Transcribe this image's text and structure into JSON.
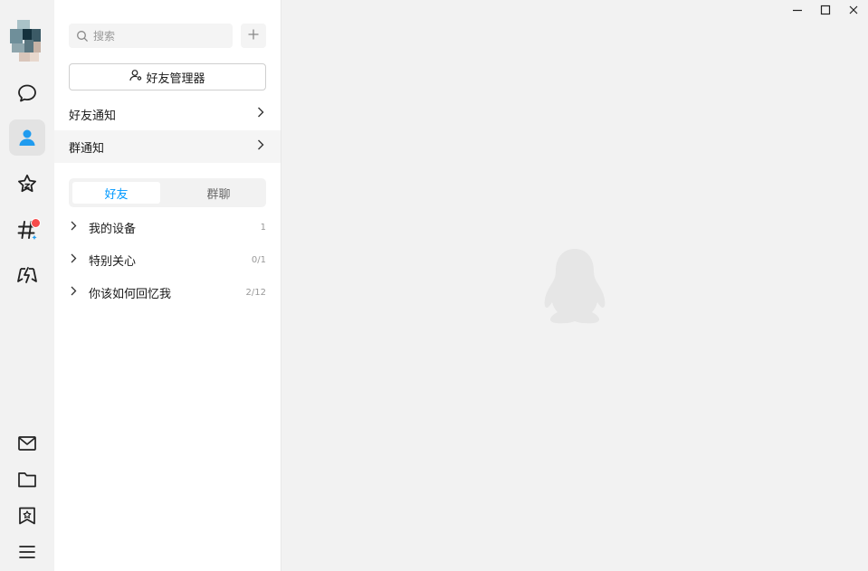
{
  "search": {
    "placeholder": "搜索"
  },
  "panel": {
    "manager_button": "好友管理器",
    "friend_notice": "好友通知",
    "group_notice": "群通知",
    "tabs": [
      {
        "label": "好友"
      },
      {
        "label": "群聊"
      }
    ],
    "groups": [
      {
        "name": "我的设备",
        "count": "1"
      },
      {
        "name": "特别关心",
        "count": "0/1"
      },
      {
        "name": "你该如何回忆我",
        "count": "2/12"
      }
    ]
  },
  "icons": {
    "rail_top": [
      "chat-bubble-icon",
      "contacts-person-icon",
      "star-icon",
      "channel-hash-icon",
      "game-lightning-icon"
    ],
    "rail_bottom": [
      "mail-icon",
      "folder-icon",
      "bookmark-star-icon",
      "menu-icon"
    ],
    "window": [
      "minimize-icon",
      "maximize-icon",
      "close-icon"
    ]
  },
  "colors": {
    "accent": "#0099ff",
    "badge": "#f74c4c",
    "active_rail_icon": "#1f9bef"
  }
}
